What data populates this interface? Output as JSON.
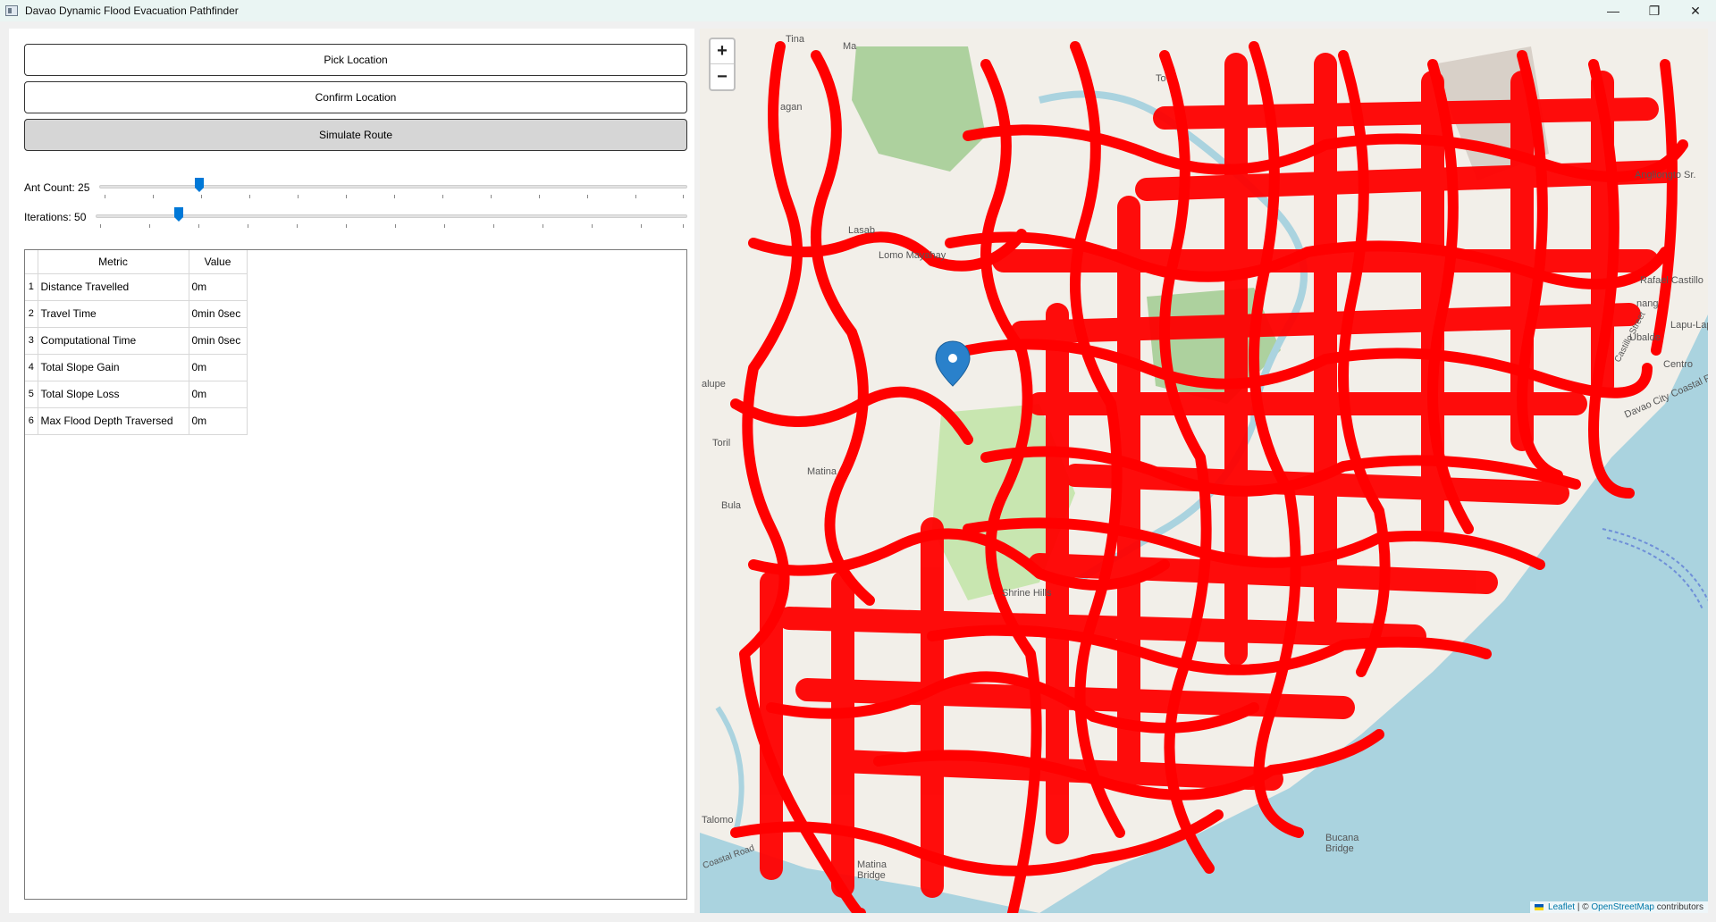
{
  "window": {
    "title": "Davao Dynamic Flood Evacuation Pathfinder",
    "minimize": "—",
    "restore": "❐",
    "close": "✕"
  },
  "controls": {
    "pick_label": "Pick Location",
    "confirm_label": "Confirm Location",
    "simulate_label": "Simulate Route"
  },
  "sliders": {
    "ant_count_label": "Ant Count: 25",
    "ant_count_value": 25,
    "iterations_label": "Iterations: 50",
    "iterations_value": 50
  },
  "table": {
    "headers": [
      "Metric",
      "Value"
    ],
    "rows": [
      {
        "num": "1",
        "metric": "Distance Travelled",
        "value": "0m"
      },
      {
        "num": "2",
        "metric": "Travel Time",
        "value": "0min 0sec"
      },
      {
        "num": "3",
        "metric": "Computational Time",
        "value": "0min 0sec"
      },
      {
        "num": "4",
        "metric": "Total Slope Gain",
        "value": "0m"
      },
      {
        "num": "5",
        "metric": "Total Slope Loss",
        "value": "0m"
      },
      {
        "num": "6",
        "metric": "Max Flood Depth Traversed",
        "value": "0m"
      }
    ]
  },
  "map": {
    "zoom_in": "+",
    "zoom_out": "−",
    "attribution_leaflet": "Leaflet",
    "attribution_sep": " | © ",
    "attribution_osm": "OpenStreetMap",
    "attribution_tail": " contributors",
    "route_color": "#ff0000",
    "marker_color": "#2a81cb",
    "water_color": "#aad3df",
    "labels": {
      "tina": "Tina",
      "ma": "Ma",
      "agan": "agan",
      "to": "To",
      "lasab": "Lasab",
      "lomayahay": "Lomo Mayahay",
      "alupe": "alupe",
      "toril": "Toril",
      "matina": "Matina",
      "bula": "Bula",
      "shrine_hills": "Shrine Hills",
      "angliongto": "Angliongto Sr.",
      "rafael": "Rafael Castillo",
      "lapu": "Lapu-Lap",
      "ubalde": "Ubalde",
      "centro": "Centro",
      "coastal": "Davao City Coastal Road",
      "bucana": "Bucana Bridge",
      "talomo": "Talomo",
      "matina2": "Matina Bridge",
      "castillo": "Castillo Street",
      "coastal_road": "Coastal Road",
      "nang": "nang"
    }
  }
}
